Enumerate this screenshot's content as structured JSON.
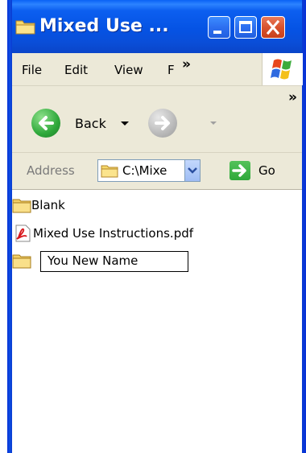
{
  "window": {
    "title": "Mixed Use ...",
    "controls": {
      "minimize": "minimize",
      "maximize": "maximize",
      "close": "close"
    }
  },
  "menu": {
    "items": [
      "File",
      "Edit",
      "View",
      "F"
    ],
    "overflow": "»"
  },
  "toolbar": {
    "back_label": "Back",
    "overflow": "»"
  },
  "address": {
    "label": "Address",
    "value": "C:\\Mixe",
    "go_label": "Go"
  },
  "files": [
    {
      "name": "Blank",
      "type": "folder-icon"
    },
    {
      "name": "Mixed Use Instructions.pdf",
      "type": "pdf-icon"
    },
    {
      "name": "",
      "type": "folder-icon"
    }
  ],
  "rename": {
    "value": "You New Name"
  },
  "colors": {
    "titlebar": "#0553e4",
    "chrome": "#ece9d8",
    "close": "#d8522d",
    "go_green": "#2ea83a",
    "folder": "#f3d066"
  }
}
